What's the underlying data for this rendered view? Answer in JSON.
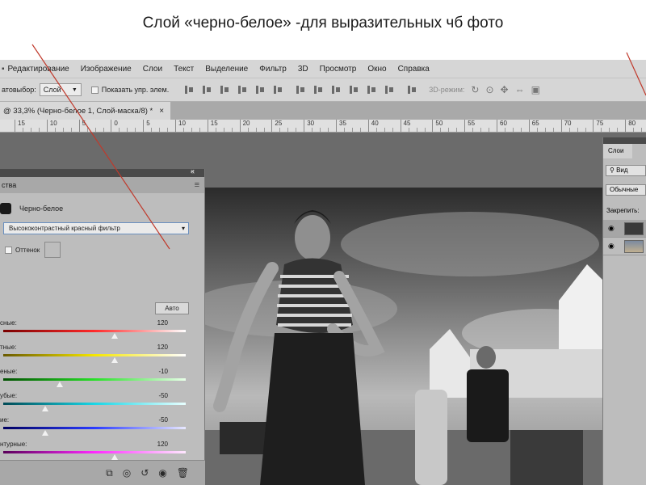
{
  "slide": {
    "title": "Слой «черно-белое»  -для выразительных чб фото"
  },
  "menubar": {
    "items": [
      "Редактирование",
      "Изображение",
      "Слои",
      "Текст",
      "Выделение",
      "Фильтр",
      "3D",
      "Просмотр",
      "Окно",
      "Справка"
    ]
  },
  "options": {
    "autoselect_label": "атовыбор:",
    "autoselect_value": "Слой",
    "show_controls_label": "Показать упр. элем.",
    "mode_3d_label": "3D-режим:"
  },
  "document_tab": {
    "label": "@ 33,3% (Черно-белое 1, Слой-маска/8) *",
    "close": "×"
  },
  "ruler": {
    "marks": [
      "15",
      "10",
      "5",
      "0",
      "5",
      "10",
      "15",
      "20",
      "25",
      "30",
      "35",
      "40",
      "45",
      "50",
      "55",
      "60",
      "65",
      "70",
      "75",
      "80"
    ]
  },
  "properties": {
    "title": "ства",
    "collapse_glyph": "«",
    "close_glyph": "×",
    "adjustment_name": "Черно-белое",
    "preset_label": "Высококонтрастный красный фильтр",
    "tint_label": "Оттенок",
    "auto_button": "Авто",
    "sliders": [
      {
        "label": "сные:",
        "value": "120",
        "fraction": 0.61,
        "gradient": "linear-gradient(to right,#7a0000,#ff2a2a,#ffffff)"
      },
      {
        "label": "тные:",
        "value": "120",
        "fraction": 0.61,
        "gradient": "linear-gradient(to right,#6a5a00,#f5e600,#ffffff)"
      },
      {
        "label": "еные:",
        "value": "-10",
        "fraction": 0.31,
        "gradient": "linear-gradient(to right,#005000,#27e027,#e8ffe8)"
      },
      {
        "label": "убые:",
        "value": "-50",
        "fraction": 0.23,
        "gradient": "linear-gradient(to right,#004a55,#19d6e6,#e8ffff)"
      },
      {
        "label": "ие:",
        "value": "-50",
        "fraction": 0.23,
        "gradient": "linear-gradient(to right,#000060,#2a3bff,#e8e8ff)"
      },
      {
        "label": "нтурные:",
        "value": "120",
        "fraction": 0.61,
        "gradient": "linear-gradient(to right,#5a005a,#ff2aff,#ffe8ff)"
      }
    ],
    "footer_icons": [
      "clip-to-layer-icon",
      "view-previous-icon",
      "reset-icon",
      "visibility-icon",
      "trash-icon"
    ]
  },
  "layers_panel": {
    "tab_label": "Слои",
    "filter_label": "Вид",
    "blend_mode": "Обычные",
    "lock_label": "Закрепить:"
  }
}
